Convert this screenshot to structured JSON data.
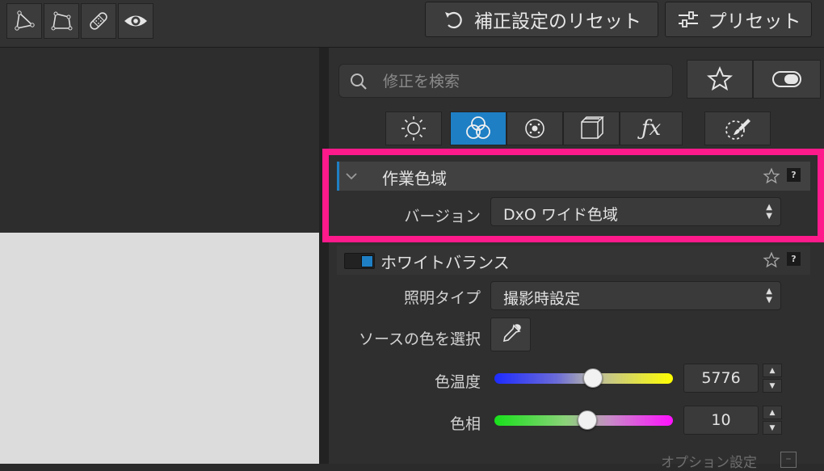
{
  "toolbar": {
    "reset_label": "補正設定のリセット",
    "preset_label": "プリセット",
    "tools": [
      "perspective-tool-icon",
      "local-adjust-tool-icon",
      "repair-tool-icon",
      "eye-icon"
    ]
  },
  "search": {
    "placeholder": "修正を検索"
  },
  "palette_tabs": [
    {
      "name": "light",
      "glyph": "☀",
      "active": false
    },
    {
      "name": "color",
      "glyph": "◎",
      "active": true
    },
    {
      "name": "detail",
      "glyph": "◉",
      "active": false
    },
    {
      "name": "geometry",
      "glyph": "▣",
      "active": false
    },
    {
      "name": "effects",
      "glyph": "ƒx",
      "active": false
    }
  ],
  "sections": {
    "working_color_space": {
      "title": "作業色域",
      "version_label": "バージョン",
      "version_value": "DxO ワイド色域"
    },
    "white_balance": {
      "title": "ホワイトバランス",
      "illuminant_label": "照明タイプ",
      "illuminant_value": "撮影時設定",
      "source_color_label": "ソースの色を選択",
      "temperature_label": "色温度",
      "temperature_value": "5776",
      "temperature_position": 0.55,
      "tint_label": "色相",
      "tint_value": "10",
      "tint_position": 0.52,
      "options_label": "オプション設定"
    }
  },
  "help_label": "?",
  "colors": {
    "accent": "#1e7fc4",
    "highlight": "#ff1a8c"
  }
}
